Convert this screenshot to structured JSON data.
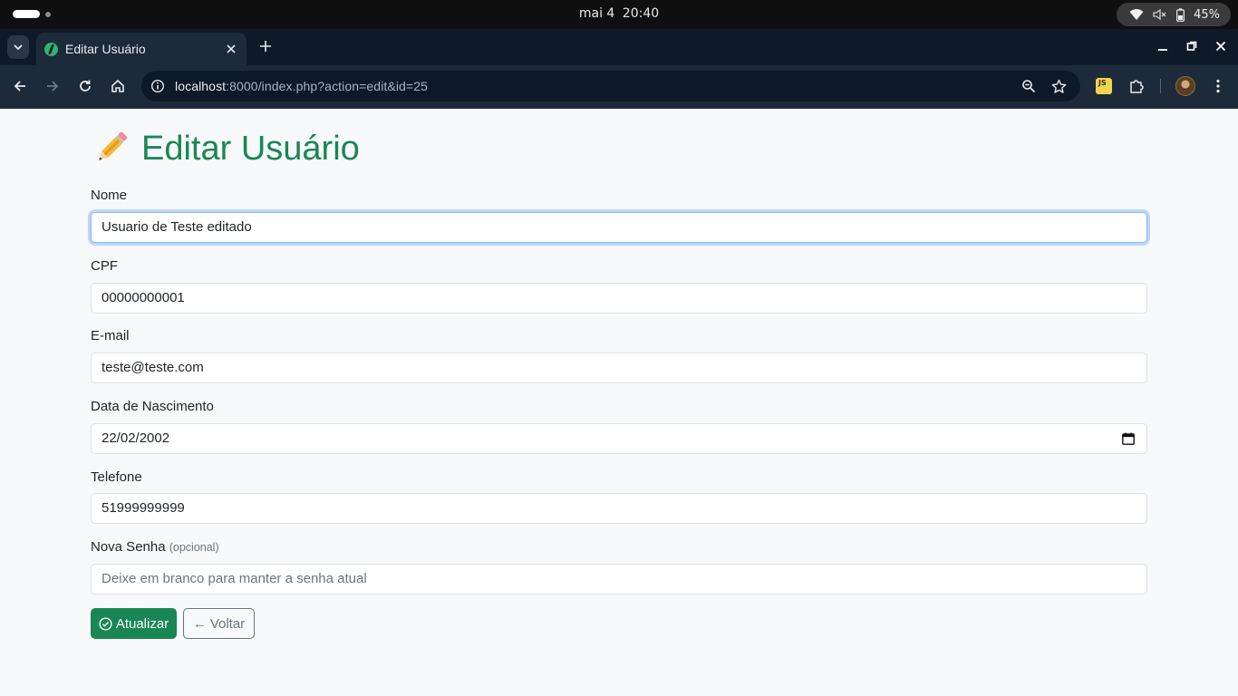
{
  "system": {
    "date": "mai 4",
    "time": "20:40",
    "battery": "45%"
  },
  "browser": {
    "tab_title": "Editar Usuário",
    "url_host": "localhost",
    "url_rest": ":8000/index.php?action=edit&id=25",
    "extension_label": "JS"
  },
  "page": {
    "title": "Editar Usuário",
    "fields": {
      "nome": {
        "label": "Nome",
        "value": "Usuario de Teste editado"
      },
      "cpf": {
        "label": "CPF",
        "value": "00000000001"
      },
      "email": {
        "label": "E-mail",
        "value": "teste@teste.com"
      },
      "nascimento": {
        "label": "Data de Nascimento",
        "value": "22/02/2002"
      },
      "telefone": {
        "label": "Telefone",
        "value": "51999999999"
      },
      "senha": {
        "label": "Nova Senha",
        "hint": "(opcional)",
        "placeholder": "Deixe em branco para manter a senha atual"
      }
    },
    "buttons": {
      "submit": "Atualizar",
      "back": "Voltar",
      "back_arrow": "←"
    }
  },
  "colors": {
    "accent": "#198754",
    "focus_border": "#86b7fe",
    "chrome_dark": "#1d2a3a"
  }
}
